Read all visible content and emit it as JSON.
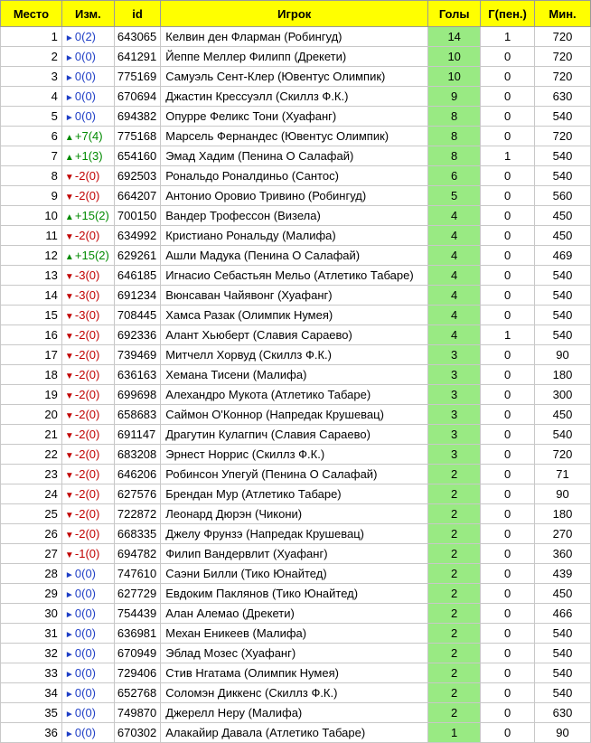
{
  "headers": [
    "Место",
    "Изм.",
    "id",
    "Игрок",
    "Голы",
    "Г(пен.)",
    "Мин."
  ],
  "arrows": {
    "same": "►",
    "up": "▲",
    "down": "▼"
  },
  "colors": {
    "header_bg": "#ffff00",
    "goals_bg": "#99ea83",
    "same": "#1f3fc6",
    "up": "#008a00",
    "down": "#c00000"
  },
  "rows": [
    {
      "place": "1",
      "dir": "same",
      "change": "0(2)",
      "id": "643065",
      "player": "Келвин ден Фларман (Робингуд)",
      "goals": "14",
      "pen": "1",
      "min": "720"
    },
    {
      "place": "2",
      "dir": "same",
      "change": "0(0)",
      "id": "641291",
      "player": "Йеппе Меллер Филипп (Дрекети)",
      "goals": "10",
      "pen": "0",
      "min": "720"
    },
    {
      "place": "3",
      "dir": "same",
      "change": "0(0)",
      "id": "775169",
      "player": "Самуэль Сент-Клер (Ювентус Олимпик)",
      "goals": "10",
      "pen": "0",
      "min": "720"
    },
    {
      "place": "4",
      "dir": "same",
      "change": "0(0)",
      "id": "670694",
      "player": "Джастин Крессуэлл (Скиллз Ф.К.)",
      "goals": "9",
      "pen": "0",
      "min": "630"
    },
    {
      "place": "5",
      "dir": "same",
      "change": "0(0)",
      "id": "694382",
      "player": "Опурре Феликс Тони (Хуафанг)",
      "goals": "8",
      "pen": "0",
      "min": "540"
    },
    {
      "place": "6",
      "dir": "up",
      "change": "+7(4)",
      "id": "775168",
      "player": "Марсель Фернандес (Ювентус Олимпик)",
      "goals": "8",
      "pen": "0",
      "min": "720"
    },
    {
      "place": "7",
      "dir": "up",
      "change": "+1(3)",
      "id": "654160",
      "player": "Эмад Хадим (Пенина О Салафай)",
      "goals": "8",
      "pen": "1",
      "min": "540"
    },
    {
      "place": "8",
      "dir": "down",
      "change": "-2(0)",
      "id": "692503",
      "player": "Рональдо Роналдиньо (Сантос)",
      "goals": "6",
      "pen": "0",
      "min": "540"
    },
    {
      "place": "9",
      "dir": "down",
      "change": "-2(0)",
      "id": "664207",
      "player": "Антонио Оровио Тривино (Робингуд)",
      "goals": "5",
      "pen": "0",
      "min": "560"
    },
    {
      "place": "10",
      "dir": "up",
      "change": "+15(2)",
      "id": "700150",
      "player": "Вандер Трофессон (Визела)",
      "goals": "4",
      "pen": "0",
      "min": "450"
    },
    {
      "place": "11",
      "dir": "down",
      "change": "-2(0)",
      "id": "634992",
      "player": "Кристиано Рональду (Малифа)",
      "goals": "4",
      "pen": "0",
      "min": "450"
    },
    {
      "place": "12",
      "dir": "up",
      "change": "+15(2)",
      "id": "629261",
      "player": "Ашли Мадука (Пенина О Салафай)",
      "goals": "4",
      "pen": "0",
      "min": "469"
    },
    {
      "place": "13",
      "dir": "down",
      "change": "-3(0)",
      "id": "646185",
      "player": "Игнасио Себастьян Мельо (Атлетико Табаре)",
      "goals": "4",
      "pen": "0",
      "min": "540"
    },
    {
      "place": "14",
      "dir": "down",
      "change": "-3(0)",
      "id": "691234",
      "player": "Вюнсаван Чайявонг (Хуафанг)",
      "goals": "4",
      "pen": "0",
      "min": "540"
    },
    {
      "place": "15",
      "dir": "down",
      "change": "-3(0)",
      "id": "708445",
      "player": "Хамса Разак (Олимпик Нумея)",
      "goals": "4",
      "pen": "0",
      "min": "540"
    },
    {
      "place": "16",
      "dir": "down",
      "change": "-2(0)",
      "id": "692336",
      "player": "Алант Хьюберт (Славия Сараево)",
      "goals": "4",
      "pen": "1",
      "min": "540"
    },
    {
      "place": "17",
      "dir": "down",
      "change": "-2(0)",
      "id": "739469",
      "player": "Митчелл Хорвуд (Скиллз Ф.К.)",
      "goals": "3",
      "pen": "0",
      "min": "90"
    },
    {
      "place": "18",
      "dir": "down",
      "change": "-2(0)",
      "id": "636163",
      "player": "Хемана Тисени (Малифа)",
      "goals": "3",
      "pen": "0",
      "min": "180"
    },
    {
      "place": "19",
      "dir": "down",
      "change": "-2(0)",
      "id": "699698",
      "player": "Алехандро Мукота (Атлетико Табаре)",
      "goals": "3",
      "pen": "0",
      "min": "300"
    },
    {
      "place": "20",
      "dir": "down",
      "change": "-2(0)",
      "id": "658683",
      "player": "Саймон О'Коннор (Напредак Крушевац)",
      "goals": "3",
      "pen": "0",
      "min": "450"
    },
    {
      "place": "21",
      "dir": "down",
      "change": "-2(0)",
      "id": "691147",
      "player": "Драгутин Кулагпич (Славия Сараево)",
      "goals": "3",
      "pen": "0",
      "min": "540"
    },
    {
      "place": "22",
      "dir": "down",
      "change": "-2(0)",
      "id": "683208",
      "player": "Эрнест Норрис (Скиллз Ф.К.)",
      "goals": "3",
      "pen": "0",
      "min": "720"
    },
    {
      "place": "23",
      "dir": "down",
      "change": "-2(0)",
      "id": "646206",
      "player": "Робинсон Упегуй (Пенина О Салафай)",
      "goals": "2",
      "pen": "0",
      "min": "71"
    },
    {
      "place": "24",
      "dir": "down",
      "change": "-2(0)",
      "id": "627576",
      "player": "Брендан Мур (Атлетико Табаре)",
      "goals": "2",
      "pen": "0",
      "min": "90"
    },
    {
      "place": "25",
      "dir": "down",
      "change": "-2(0)",
      "id": "722872",
      "player": "Леонард Дюрэн (Чикони)",
      "goals": "2",
      "pen": "0",
      "min": "180"
    },
    {
      "place": "26",
      "dir": "down",
      "change": "-2(0)",
      "id": "668335",
      "player": "Джелу Фрунзэ (Напредак Крушевац)",
      "goals": "2",
      "pen": "0",
      "min": "270"
    },
    {
      "place": "27",
      "dir": "down",
      "change": "-1(0)",
      "id": "694782",
      "player": "Филип Вандервлит (Хуафанг)",
      "goals": "2",
      "pen": "0",
      "min": "360"
    },
    {
      "place": "28",
      "dir": "same",
      "change": "0(0)",
      "id": "747610",
      "player": "Саэни Билли (Тико Юнайтед)",
      "goals": "2",
      "pen": "0",
      "min": "439"
    },
    {
      "place": "29",
      "dir": "same",
      "change": "0(0)",
      "id": "627729",
      "player": "Евдоким Паклянов (Тико Юнайтед)",
      "goals": "2",
      "pen": "0",
      "min": "450"
    },
    {
      "place": "30",
      "dir": "same",
      "change": "0(0)",
      "id": "754439",
      "player": "Алан Алемао (Дрекети)",
      "goals": "2",
      "pen": "0",
      "min": "466"
    },
    {
      "place": "31",
      "dir": "same",
      "change": "0(0)",
      "id": "636981",
      "player": "Механ Еникеев (Малифа)",
      "goals": "2",
      "pen": "0",
      "min": "540"
    },
    {
      "place": "32",
      "dir": "same",
      "change": "0(0)",
      "id": "670949",
      "player": "Эблад Мозес (Хуафанг)",
      "goals": "2",
      "pen": "0",
      "min": "540"
    },
    {
      "place": "33",
      "dir": "same",
      "change": "0(0)",
      "id": "729406",
      "player": "Стив Нгатама (Олимпик Нумея)",
      "goals": "2",
      "pen": "0",
      "min": "540"
    },
    {
      "place": "34",
      "dir": "same",
      "change": "0(0)",
      "id": "652768",
      "player": "Соломэн Диккенс (Скиллз Ф.К.)",
      "goals": "2",
      "pen": "0",
      "min": "540"
    },
    {
      "place": "35",
      "dir": "same",
      "change": "0(0)",
      "id": "749870",
      "player": "Джерелл Неру (Малифа)",
      "goals": "2",
      "pen": "0",
      "min": "630"
    },
    {
      "place": "36",
      "dir": "same",
      "change": "0(0)",
      "id": "670302",
      "player": "Алакайир Давала (Атлетико Табаре)",
      "goals": "1",
      "pen": "0",
      "min": "90"
    }
  ]
}
